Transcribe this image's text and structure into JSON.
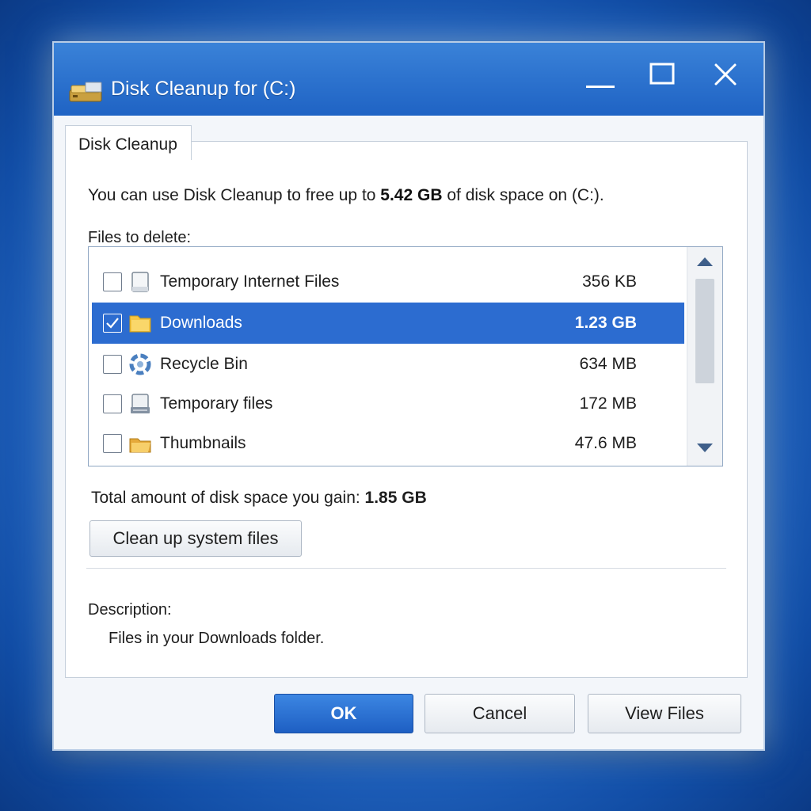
{
  "window": {
    "title": "Disk Cleanup for (C:)",
    "icon": "disk-drive-icon",
    "controls": {
      "minimize": "minimize-icon",
      "maximize": "maximize-icon",
      "close": "close-icon"
    }
  },
  "tab": {
    "label": "Disk Cleanup"
  },
  "intro": {
    "prefix": "You can use Disk Cleanup to free up to ",
    "amount": "5.42 GB",
    "suffix": " of disk space on (C:)."
  },
  "files_label": "Files to delete:",
  "files": [
    {
      "name": "Temporary Internet Files",
      "size": "356 KB",
      "checked": false,
      "selected": false,
      "icon": "page-icon"
    },
    {
      "name": "Downloads",
      "size": "1.23 GB",
      "checked": true,
      "selected": true,
      "icon": "folder-icon"
    },
    {
      "name": "Recycle Bin",
      "size": "634 MB",
      "checked": false,
      "selected": false,
      "icon": "recycle-icon"
    },
    {
      "name": "Temporary files",
      "size": "172 MB",
      "checked": false,
      "selected": false,
      "icon": "drive-icon"
    },
    {
      "name": "Thumbnails",
      "size": "47.6 MB",
      "checked": false,
      "selected": false,
      "icon": "open-folder-icon"
    }
  ],
  "total": {
    "label": "Total amount of disk space you gain: ",
    "value": "1.85 GB"
  },
  "buttons": {
    "cleanup_system": "Clean up system files",
    "ok": "OK",
    "cancel": "Cancel",
    "view_files": "View Files"
  },
  "description": {
    "label": "Description:",
    "text": "Files in your Downloads folder."
  },
  "colors": {
    "titlebar": "#1f63c4",
    "selection": "#2c6cd0",
    "ok_button": "#2a70d4"
  }
}
